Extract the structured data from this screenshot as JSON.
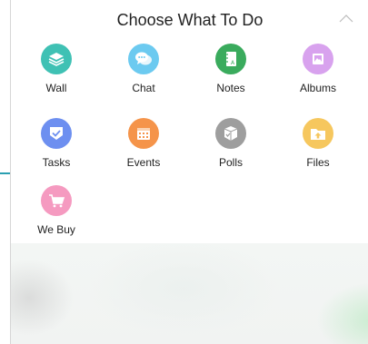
{
  "panel": {
    "title": "Choose What To Do"
  },
  "items": [
    {
      "label": "Wall",
      "icon": "wall-layers-icon",
      "color": "#3fc1b4"
    },
    {
      "label": "Chat",
      "icon": "chat-bubbles-icon",
      "color": "#6ccaf0"
    },
    {
      "label": "Notes",
      "icon": "notebook-icon",
      "color": "#3aab5d"
    },
    {
      "label": "Albums",
      "icon": "album-photo-icon",
      "color": "#d8a2ee"
    },
    {
      "label": "Tasks",
      "icon": "task-check-icon",
      "color": "#6d8ff0"
    },
    {
      "label": "Events",
      "icon": "calendar-icon",
      "color": "#f5944a"
    },
    {
      "label": "Polls",
      "icon": "poll-box-icon",
      "color": "#9e9e9e"
    },
    {
      "label": "Files",
      "icon": "file-upload-icon",
      "color": "#f6c75e"
    },
    {
      "label": "We Buy",
      "icon": "shopping-cart-icon",
      "color": "#f59ac0"
    }
  ],
  "colors": {
    "accent_line": "#2a9fb1"
  }
}
